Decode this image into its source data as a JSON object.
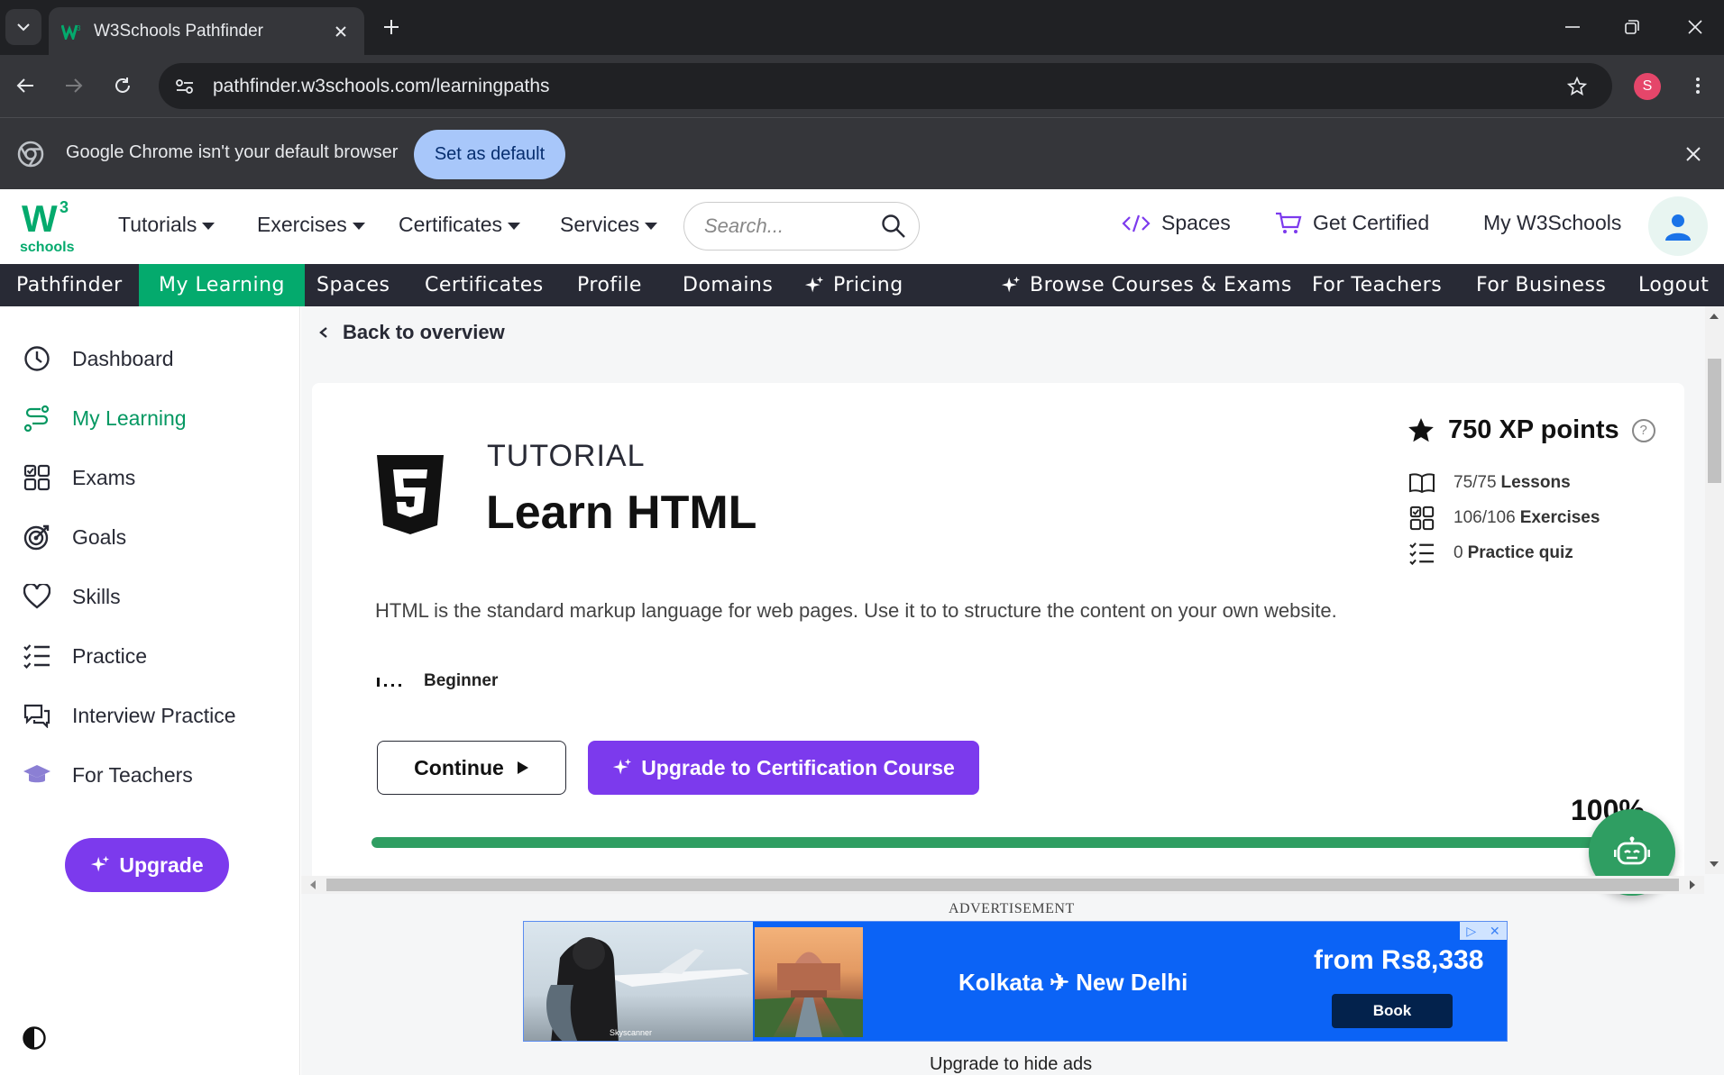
{
  "browser": {
    "tab_title": "W3Schools Pathfinder",
    "url": "pathfinder.w3schools.com/learningpaths",
    "profile_initial": "S",
    "infobar_text": "Google Chrome isn't your default browser",
    "infobar_button": "Set as default"
  },
  "header": {
    "logo_text": "w3",
    "logo_sup": "3",
    "logo_sub": "schools",
    "menu": [
      "Tutorials",
      "Exercises",
      "Certificates",
      "Services"
    ],
    "search_placeholder": "Search...",
    "spaces": "Spaces",
    "get_certified": "Get Certified",
    "my_w3schools": "My W3Schools"
  },
  "darknav": {
    "items": [
      "Pathfinder",
      "My Learning",
      "Spaces",
      "Certificates",
      "Profile",
      "Domains",
      "Pricing",
      "Browse Courses & Exams",
      "For Teachers",
      "For Business",
      "Logout"
    ],
    "active": "My Learning"
  },
  "sidebar": {
    "items": [
      "Dashboard",
      "My Learning",
      "Exams",
      "Goals",
      "Skills",
      "Practice",
      "Interview Practice",
      "For Teachers"
    ],
    "upgrade": "Upgrade"
  },
  "main": {
    "back": "Back to overview",
    "kicker": "TUTORIAL",
    "title": "Learn HTML",
    "xp": "750 XP points",
    "xp_help": "?",
    "lessons_value": "75/75",
    "lessons_label": "Lessons",
    "exercises_value": "106/106",
    "exercises_label": "Exercises",
    "quiz_value": "0",
    "quiz_label": "Practice quiz",
    "description": "HTML is the standard markup language for web pages. Use it to to structure the content on your own website.",
    "level": "Beginner",
    "continue": "Continue",
    "upgrade_cert": "Upgrade to Certification Course",
    "progress_label": "100%",
    "progress": 1.0
  },
  "ad": {
    "label": "ADVERTISEMENT",
    "route": "Kolkata ✈ New Delhi",
    "price": "from Rs8,338",
    "book": "Book",
    "brand": "Skyscanner",
    "upgrade_to_hide": "Upgrade to hide ads"
  },
  "colors": {
    "w3_green": "#04aa6d",
    "purple": "#7c3aed",
    "dark_nav": "#282a35",
    "progress": "#2f9e62"
  }
}
